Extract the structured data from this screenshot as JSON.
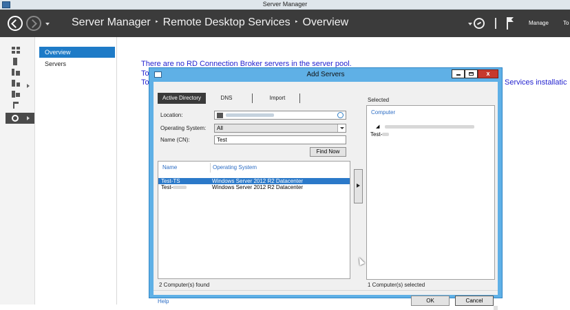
{
  "window": {
    "title": "Server Manager"
  },
  "header": {
    "breadcrumb": [
      "Server Manager",
      "Remote Desktop Services",
      "Overview"
    ],
    "separator": "‣",
    "manage_label": "Manage",
    "tools_label": "To"
  },
  "nav": {
    "items": [
      {
        "label": "Overview"
      },
      {
        "label": "Servers"
      }
    ]
  },
  "main": {
    "message": "There are no RD Connection Broker servers in the server pool.",
    "line2_start": "To",
    "line3_start": "To",
    "line3_end": "Services installatic"
  },
  "dialog": {
    "title": "Add Servers",
    "close_label": "x",
    "tabs": [
      {
        "label": "Active Directory"
      },
      {
        "label": "DNS"
      },
      {
        "label": "Import"
      }
    ],
    "location_label": "Location:",
    "os_label": "Operating System:",
    "os_value": "All",
    "name_label": "Name (CN):",
    "name_value": "Test",
    "find_now_label": "Find Now",
    "columns": [
      "Name",
      "Operating System"
    ],
    "rows": [
      {
        "name": "Test-TS",
        "os": "Windows Server 2012 R2 Datacenter",
        "selected": true
      },
      {
        "name": "Test-",
        "os": "Windows Server 2012 R2 Datacenter",
        "selected": false
      }
    ],
    "found_text": "2 Computer(s) found",
    "selected_label": "Selected",
    "selected_column": "Computer",
    "selected_items": [
      "Test-"
    ],
    "selected_count_text": "1 Computer(s) selected",
    "help_label": "Help",
    "ok_label": "OK",
    "cancel_label": "Cancel"
  },
  "colors": {
    "header_bg": "#3b3b3b",
    "accent": "#1e7bc7",
    "dialog_frame": "#5fb0e6",
    "close_button": "#c7392d",
    "link_text": "#2323cf"
  }
}
